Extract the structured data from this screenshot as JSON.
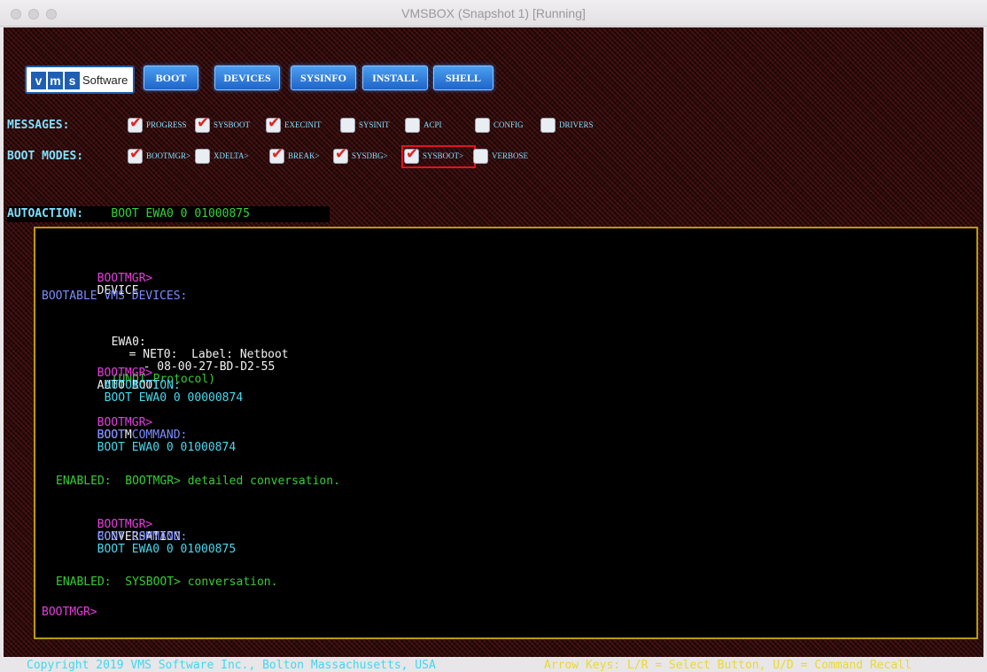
{
  "window": {
    "title": "VMSBOX (Snapshot 1) [Running]"
  },
  "logo": {
    "letters": [
      "v",
      "m",
      "s"
    ],
    "text": "Software"
  },
  "menu": {
    "buttons": [
      "BOOT",
      "DEVICES",
      "SYSINFO",
      "INSTALL",
      "SHELL"
    ]
  },
  "messages": {
    "label": "MESSAGES:",
    "options": [
      {
        "label": "PROGRESS",
        "checked": true
      },
      {
        "label": "SYSBOOT",
        "checked": true
      },
      {
        "label": "EXECINIT",
        "checked": true
      },
      {
        "label": "SYSINIT",
        "checked": false
      },
      {
        "label": "ACPI",
        "checked": false
      },
      {
        "label": "CONFIG",
        "checked": false
      },
      {
        "label": "DRIVERS",
        "checked": false
      }
    ]
  },
  "boot_modes": {
    "label": "BOOT MODES:",
    "options": [
      {
        "label": "BOOTMGR>",
        "checked": true
      },
      {
        "label": "XDELTA>",
        "checked": false
      },
      {
        "label": "BREAK>",
        "checked": true
      },
      {
        "label": "SYSDBG>",
        "checked": true
      },
      {
        "label": "SYSBOOT>",
        "checked": true,
        "highlighted": true
      },
      {
        "label": "VERBOSE",
        "checked": false
      }
    ]
  },
  "autoaction": {
    "label": "AUTOACTION:",
    "value": "BOOT EWA0 0 01000875"
  },
  "console": {
    "l1_prompt": "BOOTMGR>",
    "l1_cmd": "DEVICE",
    "l2": "BOOTABLE VMS DEVICES:",
    "l3_dev": "EWA0:",
    "l3_info": "= NET0:  Label: Netboot",
    "l3_mac": "- 08-00-27-BD-D2-55",
    "l3_proto": "(UNDI Protocol)",
    "l4_prompt": "BOOTMGR>",
    "l4_cmd": "AUTO BOOT",
    "l5_label": "AUTOACTION:",
    "l5_value": "BOOT EWA0 0 00000874",
    "l6_prompt": "BOOTMGR>",
    "l6_cmd": "BOOTM",
    "l7_label": "BOOT COMMAND:",
    "l7_value": "BOOT EWA0 0 01000874",
    "l8": "ENABLED:  BOOTMGR> detailed conversation.",
    "l9_prompt": "BOOTMGR>",
    "l9_cmd": "CONVERSATION",
    "l10_label": "BOOT COMMAND:",
    "l10_value": "BOOT EWA0 0 01000875",
    "l11": "ENABLED:  SYSBOOT> conversation.",
    "l12_prompt": "BOOTMGR>"
  },
  "footer": {
    "left": "Copyright 2019 VMS Software Inc., Bolton Massachusetts, USA",
    "right": "Arrow Keys: L/R = Select Button, U/D = Command Recall"
  }
}
